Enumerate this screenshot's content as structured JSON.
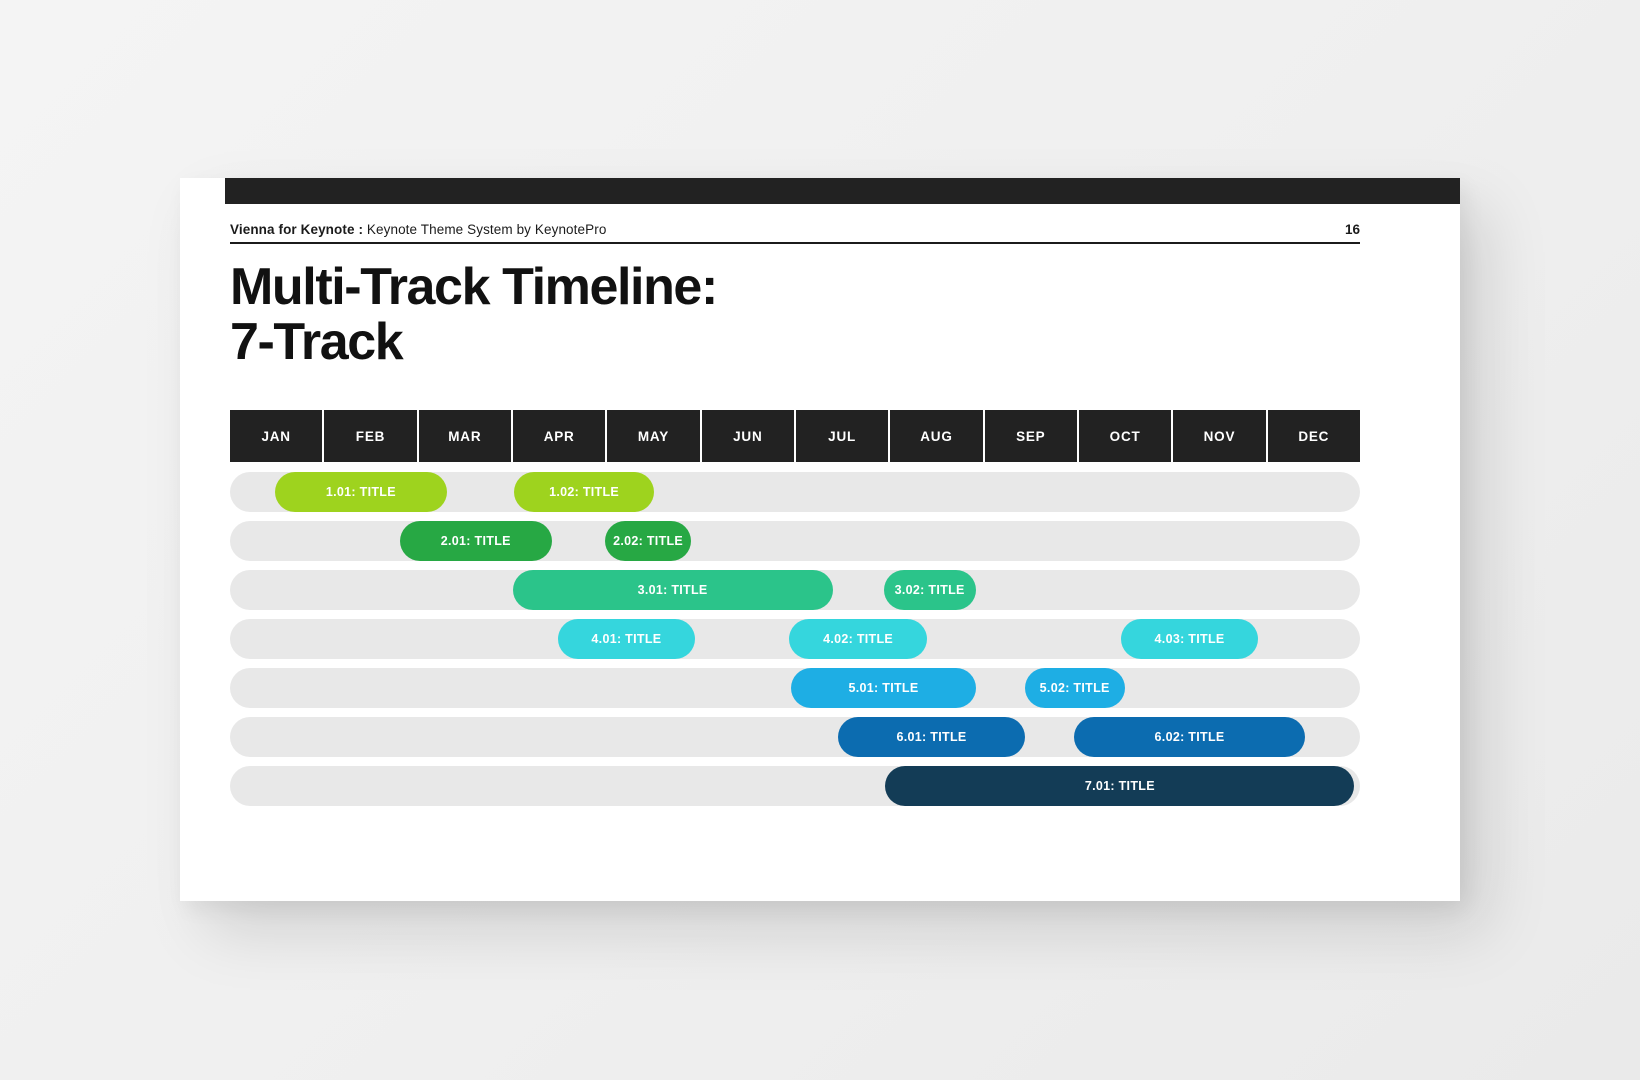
{
  "slide": {
    "header": {
      "brand": "Vienna for Keynote",
      "separator": " : ",
      "subtitle": "Keynote Theme System by KeynotePro",
      "page_number": "16"
    },
    "title": {
      "line1": "Multi-Track Timeline:",
      "line2": "7-Track"
    },
    "months": [
      "JAN",
      "FEB",
      "MAR",
      "APR",
      "MAY",
      "JUN",
      "JUL",
      "AUG",
      "SEP",
      "OCT",
      "NOV",
      "DEC"
    ],
    "colors": {
      "header_bar": "#222222",
      "track_background": "#e8e8e8",
      "slide_background": "#ffffff",
      "page_background": "#f2f2f2",
      "track_1": "#9ed31e",
      "track_2": "#27a844",
      "track_3": "#2bc48a",
      "track_4": "#35d6dd",
      "track_5": "#1eaee4",
      "track_6": "#0c6cb0",
      "track_7": "#133c56"
    },
    "tracks": [
      {
        "index": 1,
        "color": "#9ed31e",
        "bars": [
          {
            "label": "1.01: TITLE",
            "start_month": 0.48,
            "end_month": 2.3
          },
          {
            "label": "1.02: TITLE",
            "start_month": 3.02,
            "end_month": 4.5
          }
        ]
      },
      {
        "index": 2,
        "color": "#27a844",
        "bars": [
          {
            "label": "2.01: TITLE",
            "start_month": 1.8,
            "end_month": 3.42
          },
          {
            "label": "2.02: TITLE",
            "start_month": 3.98,
            "end_month": 4.9
          }
        ]
      },
      {
        "index": 3,
        "color": "#2bc48a",
        "bars": [
          {
            "label": "3.01: TITLE",
            "start_month": 3.0,
            "end_month": 6.4
          },
          {
            "label": "3.02: TITLE",
            "start_month": 6.94,
            "end_month": 7.92
          }
        ]
      },
      {
        "index": 4,
        "color": "#35d6dd",
        "bars": [
          {
            "label": "4.01: TITLE",
            "start_month": 3.48,
            "end_month": 4.94
          },
          {
            "label": "4.02: TITLE",
            "start_month": 5.94,
            "end_month": 7.4
          }
        ]
      },
      {
        "index": 5,
        "color": "#1eaee4",
        "bars": [
          {
            "label": "5.01: TITLE",
            "start_month": 5.96,
            "end_month": 7.92
          },
          {
            "label": "5.02: TITLE",
            "start_month": 8.44,
            "end_month": 9.5
          }
        ]
      },
      {
        "index": 6,
        "color": "#0c6cb0",
        "bars": [
          {
            "label": "6.01: TITLE",
            "start_month": 6.46,
            "end_month": 8.44
          },
          {
            "label": "6.02: TITLE",
            "start_month": 8.96,
            "end_month": 11.42
          }
        ]
      },
      {
        "index": 7,
        "color": "#133c56",
        "bars": [
          {
            "label": "7.01: TITLE",
            "start_month": 6.96,
            "end_month": 11.94
          }
        ]
      }
    ],
    "extra_bars": [
      {
        "track": 4,
        "label": "4.03: TITLE",
        "color": "#35d6dd",
        "start_month": 9.46,
        "end_month": 10.92
      }
    ]
  }
}
